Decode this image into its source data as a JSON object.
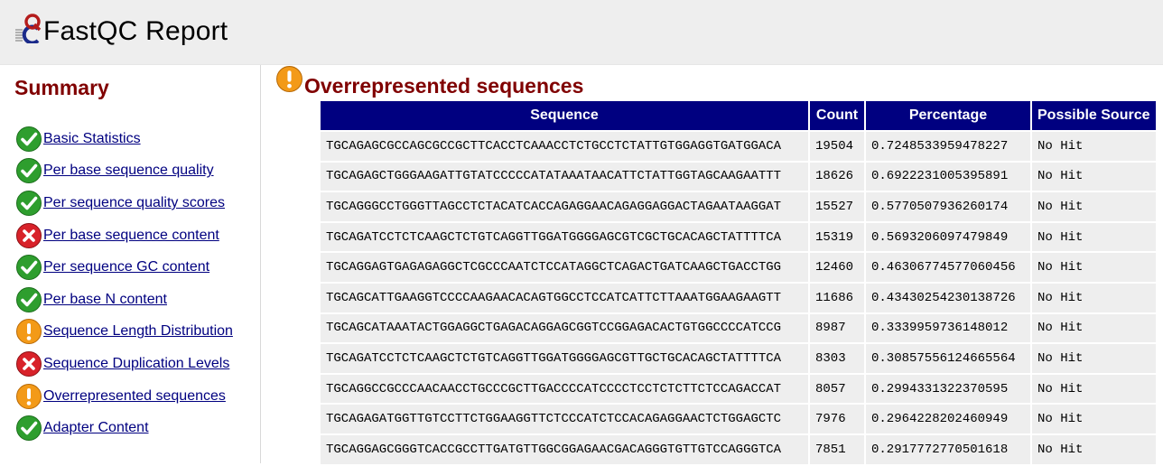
{
  "header": {
    "title": "FastQC Report"
  },
  "summary": {
    "title": "Summary",
    "modules": [
      {
        "label": "Basic Statistics",
        "status": "pass"
      },
      {
        "label": "Per base sequence quality",
        "status": "pass"
      },
      {
        "label": "Per sequence quality scores",
        "status": "pass"
      },
      {
        "label": "Per base sequence content",
        "status": "fail"
      },
      {
        "label": "Per sequence GC content",
        "status": "pass"
      },
      {
        "label": "Per base N content",
        "status": "pass"
      },
      {
        "label": "Sequence Length Distribution",
        "status": "warn"
      },
      {
        "label": "Sequence Duplication Levels",
        "status": "fail"
      },
      {
        "label": "Overrepresented sequences",
        "status": "warn"
      },
      {
        "label": "Adapter Content",
        "status": "pass"
      }
    ]
  },
  "section": {
    "title": "Overrepresented sequences",
    "status": "warn",
    "headers": [
      "Sequence",
      "Count",
      "Percentage",
      "Possible Source"
    ],
    "rows": [
      [
        "TGCAGAGCGCCAGCGCCGCTTCACCTCAAACCTCTGCCTCTATTGTGGAGGTGATGGACA",
        "19504",
        "0.7248533959478227",
        "No Hit"
      ],
      [
        "TGCAGAGCTGGGAAGATTGTATCCCCCATATAAATAACATTCTATTGGTAGCAAGAATTT",
        "18626",
        "0.6922231005395891",
        "No Hit"
      ],
      [
        "TGCAGGGCCTGGGTTAGCCTCTACATCACCAGAGGAACAGAGGAGGACTAGAATAAGGAT",
        "15527",
        "0.5770507936260174",
        "No Hit"
      ],
      [
        "TGCAGATCCTCTCAAGCTCTGTCAGGTTGGATGGGGAGCGTCGCTGCACAGCTATTTTCA",
        "15319",
        "0.5693206097479849",
        "No Hit"
      ],
      [
        "TGCAGGAGTGAGAGAGGCTCGCCCAATCTCCATAGGCTCAGACTGATCAAGCTGACCTGG",
        "12460",
        "0.46306774577060456",
        "No Hit"
      ],
      [
        "TGCAGCATTGAAGGTCCCCAAGAACACAGTGGCCTCCATCATTCTTAAATGGAAGAAGTT",
        "11686",
        "0.43430254230138726",
        "No Hit"
      ],
      [
        "TGCAGCATAAATACTGGAGGCTGAGACAGGAGCGGTCCGGAGACACTGTGGCCCCATCCG",
        "8987",
        "0.3339959736148012",
        "No Hit"
      ],
      [
        "TGCAGATCCTCTCAAGCTCTGTCAGGTTGGATGGGGAGCGTTGCTGCACAGCTATTTTCA",
        "8303",
        "0.30857556124665564",
        "No Hit"
      ],
      [
        "TGCAGGCCGCCCAACAACCTGCCCGCTTGACCCCATCCCCTCCTCTCTTCTCCAGACCAT",
        "8057",
        "0.2994331322370595",
        "No Hit"
      ],
      [
        "TGCAGAGATGGTTGTCCTTCTGGAAGGTTCTCCCATCTCCACAGAGGAACTCTGGAGCTC",
        "7976",
        "0.2964228202460949",
        "No Hit"
      ],
      [
        "TGCAGGAGCGGGTCACCGCCTTGATGTTGGCGGAGAACGACAGGGTGTTGTCCAGGGTCA",
        "7851",
        "0.2917772770501618",
        "No Hit"
      ]
    ]
  },
  "colors": {
    "header_bg": "#eeeeee",
    "title_red": "#800000",
    "link_blue": "#000080",
    "table_header_bg": "#000080",
    "cell_bg": "#eeeeee",
    "pass_green": "#2e9e2e",
    "fail_red": "#d8222a",
    "warn_orange": "#f39a18"
  }
}
